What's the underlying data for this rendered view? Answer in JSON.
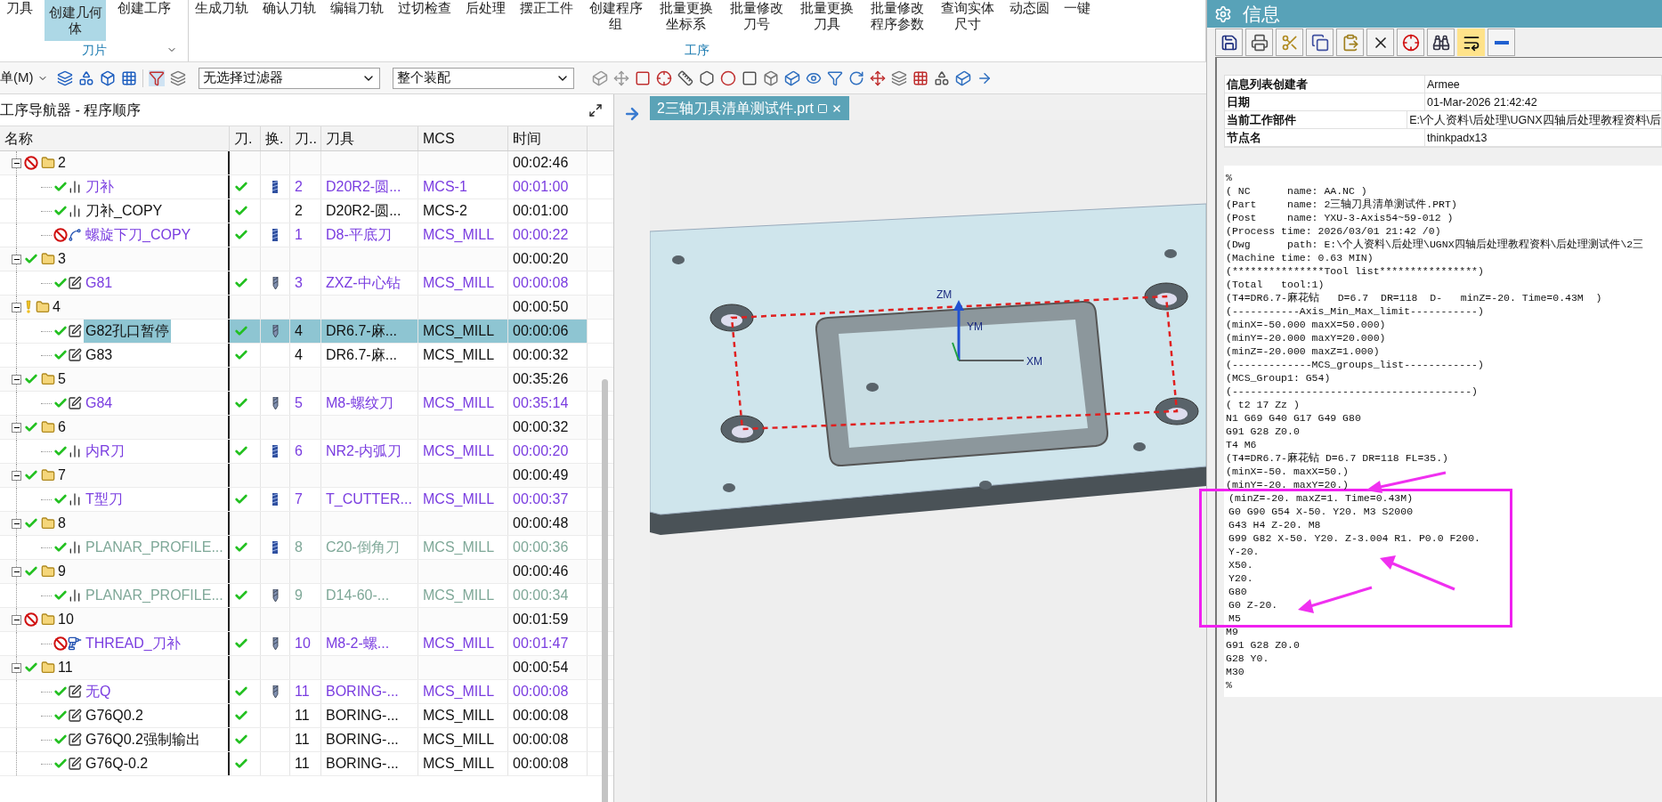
{
  "ribbon": {
    "groups": [
      {
        "label": "刀片",
        "items": [
          {
            "label": "刀具",
            "selected": false
          },
          {
            "label": "创建几何体",
            "selected": true
          },
          {
            "label": "创建工序",
            "selected": false
          }
        ]
      },
      {
        "label": "工序",
        "items": [
          {
            "label": "生成刀轨",
            "selected": false
          },
          {
            "label": "确认刀轨",
            "selected": false
          },
          {
            "label": "编辑刀轨",
            "selected": false
          },
          {
            "label": "过切检查",
            "selected": false
          },
          {
            "label": "后处理",
            "selected": false
          },
          {
            "label": "摆正工件",
            "selected": false
          },
          {
            "label": "创建程序组",
            "selected": false
          },
          {
            "label": "批量更换坐标系",
            "selected": false
          },
          {
            "label": "批量修改刀号",
            "selected": false
          },
          {
            "label": "批量更换刀具",
            "selected": false
          },
          {
            "label": "批量修改程序参数",
            "selected": false
          },
          {
            "label": "查询实体尺寸",
            "selected": false
          },
          {
            "label": "动态圆",
            "selected": false
          },
          {
            "label": "一键",
            "selected": false
          }
        ]
      }
    ]
  },
  "toolbar": {
    "menu": "单(M)",
    "filters": [
      {
        "value": "无选择过滤器"
      },
      {
        "value": "整个装配"
      }
    ]
  },
  "navigator": {
    "title": "工序导航器 - 程序顺序",
    "columns": [
      "名称",
      "刀.",
      "换.",
      "刀..",
      "刀具",
      "MCS",
      "时间"
    ],
    "groups": [
      {
        "name": "2",
        "prohibited": true,
        "warning": false,
        "expanded": true,
        "time": "00:02:46",
        "children": [
          {
            "kind": "profile",
            "name": "刀补",
            "prohibited": false,
            "path_ok": true,
            "tool": {
              "kind": "mill",
              "no": "2",
              "name": "D20R2-圆..."
            },
            "mcs": "MCS-1",
            "time": "00:01:00",
            "color": "#7a3de0",
            "selected": false
          },
          {
            "kind": "profile",
            "name": "刀补_COPY",
            "prohibited": false,
            "path_ok": true,
            "tool": {
              "no": "2",
              "name": "D20R2-圆..."
            },
            "mcs": "MCS-2",
            "time": "00:01:00",
            "selected": false
          },
          {
            "kind": "helix",
            "name": "螺旋下刀_COPY",
            "prohibited": true,
            "path_ok": true,
            "tool": {
              "kind": "mill",
              "no": "1",
              "name": "D8-平底刀"
            },
            "mcs": "MCS_MILL",
            "time": "00:00:22",
            "color": "#7a3de0",
            "selected": false
          }
        ]
      },
      {
        "name": "3",
        "prohibited": false,
        "warning": false,
        "expanded": true,
        "time": "00:00:20",
        "children": [
          {
            "kind": "drill",
            "name": "G81",
            "prohibited": false,
            "path_ok": true,
            "tool": {
              "kind": "drill",
              "no": "3",
              "name": "ZXZ-中心钻"
            },
            "mcs": "MCS_MILL",
            "time": "00:00:08",
            "color": "#7a3de0",
            "selected": false
          }
        ]
      },
      {
        "name": "4",
        "prohibited": false,
        "warning": true,
        "expanded": true,
        "time": "00:00:50",
        "children": [
          {
            "kind": "drill",
            "name": "G82孔口暂停",
            "prohibited": false,
            "path_ok": true,
            "tool": {
              "kind": "drill",
              "no": "4",
              "name": "DR6.7-麻..."
            },
            "mcs": "MCS_MILL",
            "time": "00:00:06",
            "selected": true
          },
          {
            "kind": "drill",
            "name": "G83",
            "prohibited": false,
            "path_ok": true,
            "tool": {
              "no": "4",
              "name": "DR6.7-麻..."
            },
            "mcs": "MCS_MILL",
            "time": "00:00:32",
            "selected": false
          }
        ]
      },
      {
        "name": "5",
        "prohibited": false,
        "warning": false,
        "expanded": true,
        "time": "00:35:26",
        "children": [
          {
            "kind": "drill",
            "name": "G84",
            "prohibited": false,
            "path_ok": true,
            "tool": {
              "kind": "drill",
              "no": "5",
              "name": "M8-螺纹刀"
            },
            "mcs": "MCS_MILL",
            "time": "00:35:14",
            "color": "#7a3de0",
            "selected": false
          }
        ]
      },
      {
        "name": "6",
        "prohibited": false,
        "warning": false,
        "expanded": true,
        "time": "00:00:32",
        "children": [
          {
            "kind": "profile",
            "name": "内R刀",
            "prohibited": false,
            "path_ok": true,
            "tool": {
              "kind": "mill",
              "no": "6",
              "name": "NR2-内弧刀"
            },
            "mcs": "MCS_MILL",
            "time": "00:00:20",
            "color": "#7a3de0",
            "selected": false
          }
        ]
      },
      {
        "name": "7",
        "prohibited": false,
        "warning": false,
        "expanded": true,
        "time": "00:00:49",
        "children": [
          {
            "kind": "profile",
            "name": "T型刀",
            "prohibited": false,
            "path_ok": true,
            "tool": {
              "kind": "mill",
              "no": "7",
              "name": "T_CUTTER..."
            },
            "mcs": "MCS_MILL",
            "time": "00:00:37",
            "color": "#7a3de0",
            "selected": false
          }
        ]
      },
      {
        "name": "8",
        "prohibited": false,
        "warning": false,
        "expanded": true,
        "time": "00:00:48",
        "children": [
          {
            "kind": "profile",
            "name": "PLANAR_PROFILE...",
            "prohibited": false,
            "path_ok": true,
            "tool": {
              "kind": "mill",
              "no": "8",
              "name": "C20-倒角刀"
            },
            "mcs": "MCS_MILL",
            "time": "00:00:36",
            "color": "#7fa898",
            "selected": false
          }
        ]
      },
      {
        "name": "9",
        "prohibited": false,
        "warning": false,
        "expanded": true,
        "time": "00:00:46",
        "children": [
          {
            "kind": "profile",
            "name": "PLANAR_PROFILE...",
            "prohibited": false,
            "path_ok": true,
            "tool": {
              "kind": "drill",
              "no": "9",
              "name": "D14-60-..."
            },
            "mcs": "MCS_MILL",
            "time": "00:00:34",
            "color": "#7fa898",
            "selected": false
          }
        ]
      },
      {
        "name": "10",
        "prohibited": true,
        "warning": false,
        "expanded": true,
        "time": "00:01:59",
        "children": [
          {
            "kind": "thread",
            "name": "THREAD_刀补",
            "prohibited": true,
            "path_ok": true,
            "tool": {
              "kind": "drill",
              "no": "10",
              "name": "M8-2-螺..."
            },
            "mcs": "MCS_MILL",
            "time": "00:01:47",
            "color": "#7a3de0",
            "selected": false
          }
        ]
      },
      {
        "name": "11",
        "prohibited": false,
        "warning": false,
        "expanded": true,
        "time": "00:00:54",
        "children": [
          {
            "kind": "drill",
            "name": "无Q",
            "prohibited": false,
            "path_ok": true,
            "tool": {
              "kind": "drill",
              "no": "11",
              "name": "BORING-..."
            },
            "mcs": "MCS_MILL",
            "time": "00:00:08",
            "color": "#7a3de0",
            "selected": false
          },
          {
            "kind": "drill",
            "name": "G76Q0.2",
            "prohibited": false,
            "path_ok": true,
            "tool": {
              "no": "11",
              "name": "BORING-..."
            },
            "mcs": "MCS_MILL",
            "time": "00:00:08",
            "selected": false
          },
          {
            "kind": "drill",
            "name": "G76Q0.2强制输出",
            "prohibited": false,
            "path_ok": true,
            "tool": {
              "no": "11",
              "name": "BORING-..."
            },
            "mcs": "MCS_MILL",
            "time": "00:00:08",
            "selected": false
          },
          {
            "kind": "drill",
            "name": "G76Q-0.2",
            "prohibited": false,
            "path_ok": true,
            "tool": {
              "no": "11",
              "name": "BORING-..."
            },
            "mcs": "MCS_MILL",
            "time": "00:00:08",
            "selected": false
          }
        ]
      }
    ]
  },
  "viewport": {
    "tab": {
      "label": "2三轴刀具清单测试件.prt",
      "selected": true
    },
    "axes": [
      "ZM",
      "YM",
      "XM"
    ]
  },
  "info": {
    "title": "信息",
    "tools": [
      {
        "kind": "save",
        "selected": false
      },
      {
        "kind": "print",
        "selected": false
      },
      {
        "kind": "cut",
        "selected": false
      },
      {
        "kind": "copy",
        "selected": false
      },
      {
        "kind": "paste",
        "selected": false
      },
      {
        "kind": "delete",
        "selected": false
      },
      {
        "kind": "target",
        "selected": false
      },
      {
        "kind": "find",
        "selected": false
      },
      {
        "kind": "wrap",
        "selected": true
      },
      {
        "kind": "minimize",
        "selected": false
      }
    ],
    "fields": [
      {
        "label": "信息列表创建者",
        "value": "Armee"
      },
      {
        "label": "日期",
        "value": "01-Mar-2026 21:42:42"
      },
      {
        "label": "当前工作部件",
        "value": "E:\\个人资料\\后处理\\UGNX四轴后处理教程资料\\后"
      },
      {
        "label": "节点名",
        "value": "thinkpadx13"
      }
    ],
    "code_before": [
      "%",
      "( NC      name: AA.NC )",
      "(Part     name: 2三轴刀具清单测试件.PRT)",
      "(Post     name: YXU-3-Axis54~59-012 )",
      "(Process time: 2026/03/01 21:42 /0)",
      "(Dwg      path: E:\\个人资料\\后处理\\UGNX四轴后处理教程资料\\后处理测试件\\2三",
      "(Machine time: 0.63 MIN)",
      "(***************Tool list****************)",
      "(Total   tool:1)",
      "(T4=DR6.7-麻花钻   D=6.7  DR=118  D-   minZ=-20. Time=0.43M  )",
      "(-----------Axis_Min_Max_limit-----------)",
      "(minX=-50.000 maxX=50.000)",
      "(minY=-20.000 maxY=20.000)",
      "(minZ=-20.000 maxZ=1.000)",
      "(-------------MCS_groups_list------------)",
      "(MCS_Group1: G54)",
      "(---------------------------------------)",
      "( t2 17 Zz )",
      "N1 G69 G40 G17 G49 G80",
      "G91 G28 Z0.0",
      "T4 M6",
      "(T4=DR6.7-麻花钻 D=6.7 DR=118 FL=35.)",
      "(minX=-50. maxX=50.)",
      "(minY=-20. maxY=20.)"
    ],
    "code_highlighted": [
      "(minZ=-20. maxZ=1. Time=0.43M)",
      "G0 G90 G54 X-50. Y20. M3 S2000",
      "G43 H4 Z-20. M8",
      "G99 G82 X-50. Y20. Z-3.004 R1. P0.0 F200.",
      "Y-20.",
      "X50.",
      "Y20.",
      "G80",
      "G0 Z-20.",
      "M5"
    ],
    "code_after": [
      "M9",
      "G91 G28 Z0.0",
      "G28 Y0.",
      "M30",
      "%"
    ]
  }
}
